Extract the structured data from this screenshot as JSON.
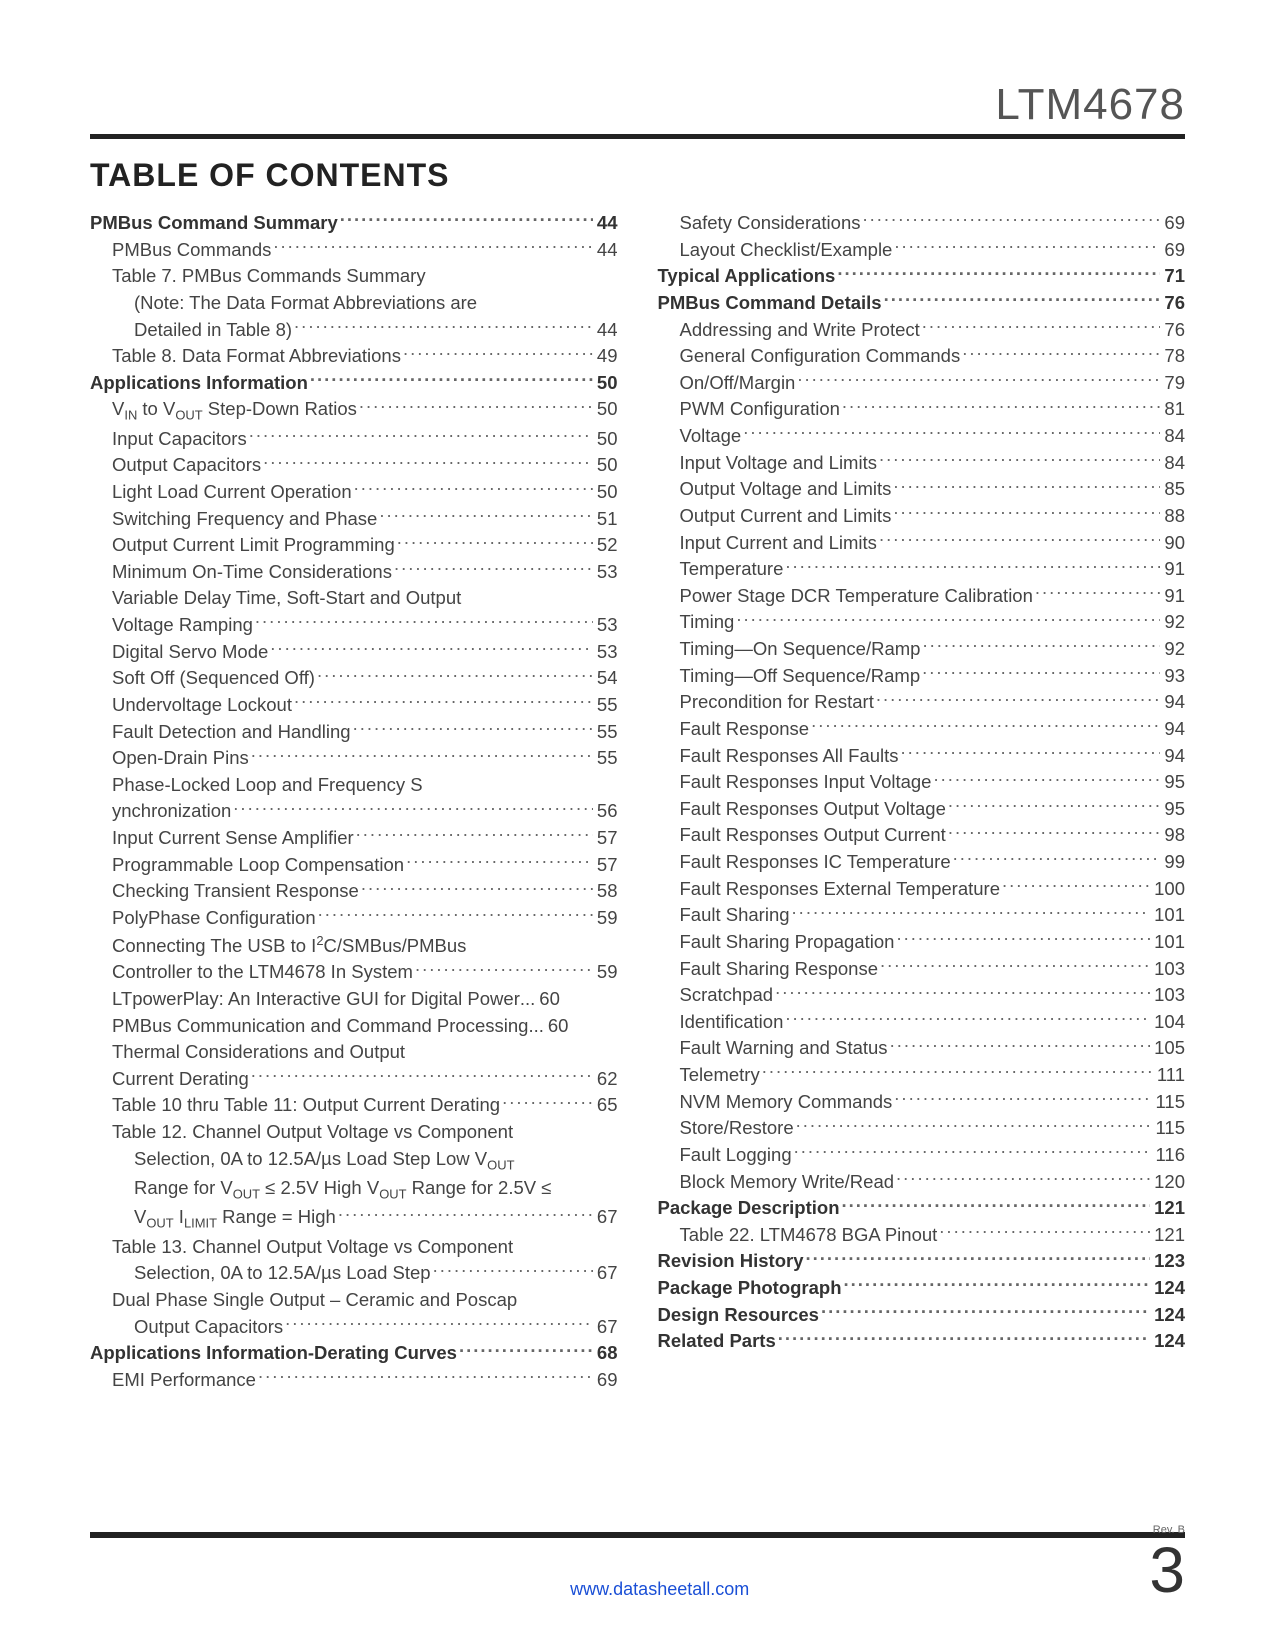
{
  "header": {
    "part_number": "LTM4678",
    "title": "TABLE OF CONTENTS"
  },
  "footer": {
    "rev": "Rev. B",
    "url": "www.datasheetall.com",
    "page": "3"
  },
  "col1": [
    {
      "label": "PMBus Command Summary",
      "page": "44",
      "bold": true,
      "indent": 0
    },
    {
      "label": "PMBus Commands",
      "page": "44",
      "indent": 1
    },
    {
      "label": "Table 7. PMBus Commands Summary",
      "indent": 1,
      "nowrap": true
    },
    {
      "label": "(Note: The Data Format Abbreviations are",
      "indent": 2,
      "nowrap": true
    },
    {
      "label": "Detailed in Table 8)",
      "page": "44",
      "indent": 2
    },
    {
      "label": "Table 8. Data Format Abbreviations",
      "page": "49",
      "indent": 1
    },
    {
      "label": "Applications Information",
      "page": "50",
      "bold": true,
      "indent": 0
    },
    {
      "html": "V<sub>IN</sub> to V<sub>OUT</sub> Step-Down Ratios",
      "page": "50",
      "indent": 1
    },
    {
      "label": "Input Capacitors",
      "page": "50",
      "indent": 1
    },
    {
      "label": "Output Capacitors",
      "page": "50",
      "indent": 1
    },
    {
      "label": "Light Load Current Operation",
      "page": "50",
      "indent": 1
    },
    {
      "label": "Switching Frequency and Phase",
      "page": "51",
      "indent": 1
    },
    {
      "label": "Output Current Limit Programming",
      "page": "52",
      "indent": 1
    },
    {
      "label": "Minimum On-Time Considerations",
      "page": "53",
      "indent": 1
    },
    {
      "label": "Variable Delay Time, Soft-Start and Output",
      "indent": 1,
      "nowrap": true
    },
    {
      "label": "Voltage Ramping",
      "page": "53",
      "indent": 1
    },
    {
      "label": "Digital Servo Mode",
      "page": "53",
      "indent": 1
    },
    {
      "label": "Soft Off (Sequenced Off)",
      "page": "54",
      "indent": 1
    },
    {
      "label": "Undervoltage Lockout",
      "page": "55",
      "indent": 1
    },
    {
      "label": "Fault Detection and Handling",
      "page": "55",
      "indent": 1
    },
    {
      "label": "Open-Drain Pins",
      "page": "55",
      "indent": 1
    },
    {
      "label": "Phase-Locked Loop and Frequency S",
      "indent": 1,
      "nowrap": true
    },
    {
      "label": "ynchronization",
      "page": "56",
      "indent": 1
    },
    {
      "label": "Input Current Sense Amplifier",
      "page": "57",
      "indent": 1
    },
    {
      "label": "Programmable Loop Compensation",
      "page": "57",
      "indent": 1
    },
    {
      "label": "Checking Transient Response",
      "page": "58",
      "indent": 1
    },
    {
      "label": "PolyPhase Configuration",
      "page": "59",
      "indent": 1
    },
    {
      "html": "Connecting The USB to I<sup>2</sup>C/SMBus/PMBus",
      "indent": 1,
      "nowrap": true
    },
    {
      "label": "Controller to the LTM4678 In System",
      "page": "59",
      "indent": 1
    },
    {
      "label": "LTpowerPlay: An Interactive GUI for Digital Power",
      "page": "60",
      "indent": 1,
      "tight": true
    },
    {
      "label": "PMBus Communication and Command Processing",
      "page": "60",
      "indent": 1,
      "tight": true
    },
    {
      "label": "Thermal Considerations and Output",
      "indent": 1,
      "nowrap": true
    },
    {
      "label": "Current Derating",
      "page": "62",
      "indent": 1
    },
    {
      "label": "Table 10 thru Table 11: Output Current Derating",
      "page": "65",
      "indent": 1
    },
    {
      "label": "Table 12. Channel Output Voltage vs Component",
      "indent": 1,
      "nowrap": true
    },
    {
      "html": "Selection, 0A to 12.5A/µs Load Step Low V<sub>OUT</sub>",
      "indent": 2,
      "nowrap": true
    },
    {
      "html": "Range for V<sub>OUT</sub> ≤ 2.5V High V<sub>OUT</sub> Range for 2.5V ≤",
      "indent": 2,
      "nowrap": true
    },
    {
      "html": "V<sub>OUT</sub> I<sub>LIMIT</sub> Range = High",
      "page": "67",
      "indent": 2
    },
    {
      "label": "Table 13. Channel Output Voltage vs Component",
      "indent": 1,
      "nowrap": true
    },
    {
      "label": "Selection, 0A to 12.5A/µs Load Step",
      "page": "67",
      "indent": 2
    },
    {
      "label": "Dual Phase Single Output – Ceramic and Poscap",
      "indent": 1,
      "nowrap": true
    },
    {
      "label": "Output Capacitors",
      "page": "67",
      "indent": 2
    },
    {
      "label": "Applications Information-Derating Curves",
      "page": "68",
      "bold": true,
      "indent": 0
    },
    {
      "label": "EMI Performance",
      "page": "69",
      "indent": 1
    }
  ],
  "col2": [
    {
      "label": "Safety Considerations",
      "page": "69",
      "indent": 1
    },
    {
      "label": "Layout Checklist/Example",
      "page": "69",
      "indent": 1
    },
    {
      "label": "Typical Applications",
      "page": "71",
      "bold": true,
      "indent": 0
    },
    {
      "label": "PMBus Command Details",
      "page": "76",
      "bold": true,
      "indent": 0
    },
    {
      "label": "Addressing and Write Protect",
      "page": "76",
      "indent": 1
    },
    {
      "label": "General Configuration Commands",
      "page": "78",
      "indent": 1
    },
    {
      "label": "On/Off/Margin",
      "page": "79",
      "indent": 1
    },
    {
      "label": "PWM Configuration",
      "page": "81",
      "indent": 1
    },
    {
      "label": "Voltage",
      "page": "84",
      "indent": 1
    },
    {
      "label": "Input Voltage and Limits",
      "page": "84",
      "indent": 1
    },
    {
      "label": "Output Voltage and Limits",
      "page": "85",
      "indent": 1
    },
    {
      "label": "Output Current and Limits",
      "page": "88",
      "indent": 1
    },
    {
      "label": "Input Current and Limits",
      "page": "90",
      "indent": 1
    },
    {
      "label": "Temperature",
      "page": "91",
      "indent": 1
    },
    {
      "label": "Power Stage DCR Temperature Calibration",
      "page": "91",
      "indent": 1
    },
    {
      "label": "Timing",
      "page": "92",
      "indent": 1
    },
    {
      "label": "Timing—On Sequence/Ramp",
      "page": "92",
      "indent": 1
    },
    {
      "label": "Timing—Off Sequence/Ramp",
      "page": "93",
      "indent": 1
    },
    {
      "label": "Precondition for Restart",
      "page": "94",
      "indent": 1
    },
    {
      "label": "Fault Response",
      "page": "94",
      "indent": 1
    },
    {
      "label": "Fault Responses All Faults",
      "page": "94",
      "indent": 1
    },
    {
      "label": "Fault Responses Input Voltage",
      "page": "95",
      "indent": 1
    },
    {
      "label": "Fault Responses Output Voltage",
      "page": "95",
      "indent": 1
    },
    {
      "label": "Fault Responses Output Current",
      "page": "98",
      "indent": 1
    },
    {
      "label": "Fault Responses IC Temperature",
      "page": "99",
      "indent": 1
    },
    {
      "label": "Fault Responses External Temperature",
      "page": "100",
      "indent": 1
    },
    {
      "label": "Fault Sharing",
      "page": "101",
      "indent": 1
    },
    {
      "label": "Fault Sharing Propagation",
      "page": "101",
      "indent": 1
    },
    {
      "label": "Fault Sharing Response",
      "page": "103",
      "indent": 1
    },
    {
      "label": "Scratchpad",
      "page": "103",
      "indent": 1
    },
    {
      "label": "Identification",
      "page": "104",
      "indent": 1
    },
    {
      "label": "Fault Warning and Status",
      "page": "105",
      "indent": 1
    },
    {
      "label": "Telemetry",
      "page": "111",
      "indent": 1
    },
    {
      "label": "NVM Memory Commands",
      "page": "115",
      "indent": 1
    },
    {
      "label": "Store/Restore",
      "page": "115",
      "indent": 1
    },
    {
      "label": "Fault Logging",
      "page": "116",
      "indent": 1
    },
    {
      "label": "Block Memory Write/Read",
      "page": "120",
      "indent": 1
    },
    {
      "label": "Package Description",
      "page": "121",
      "bold": true,
      "indent": 0
    },
    {
      "label": "Table 22. LTM4678 BGA Pinout",
      "page": "121",
      "indent": 1
    },
    {
      "label": "Revision History",
      "page": "123",
      "bold": true,
      "indent": 0
    },
    {
      "label": "Package Photograph",
      "page": "124",
      "bold": true,
      "indent": 0
    },
    {
      "label": "Design Resources",
      "page": "124",
      "bold": true,
      "indent": 0
    },
    {
      "label": "Related Parts",
      "page": "124",
      "bold": true,
      "indent": 0
    }
  ]
}
